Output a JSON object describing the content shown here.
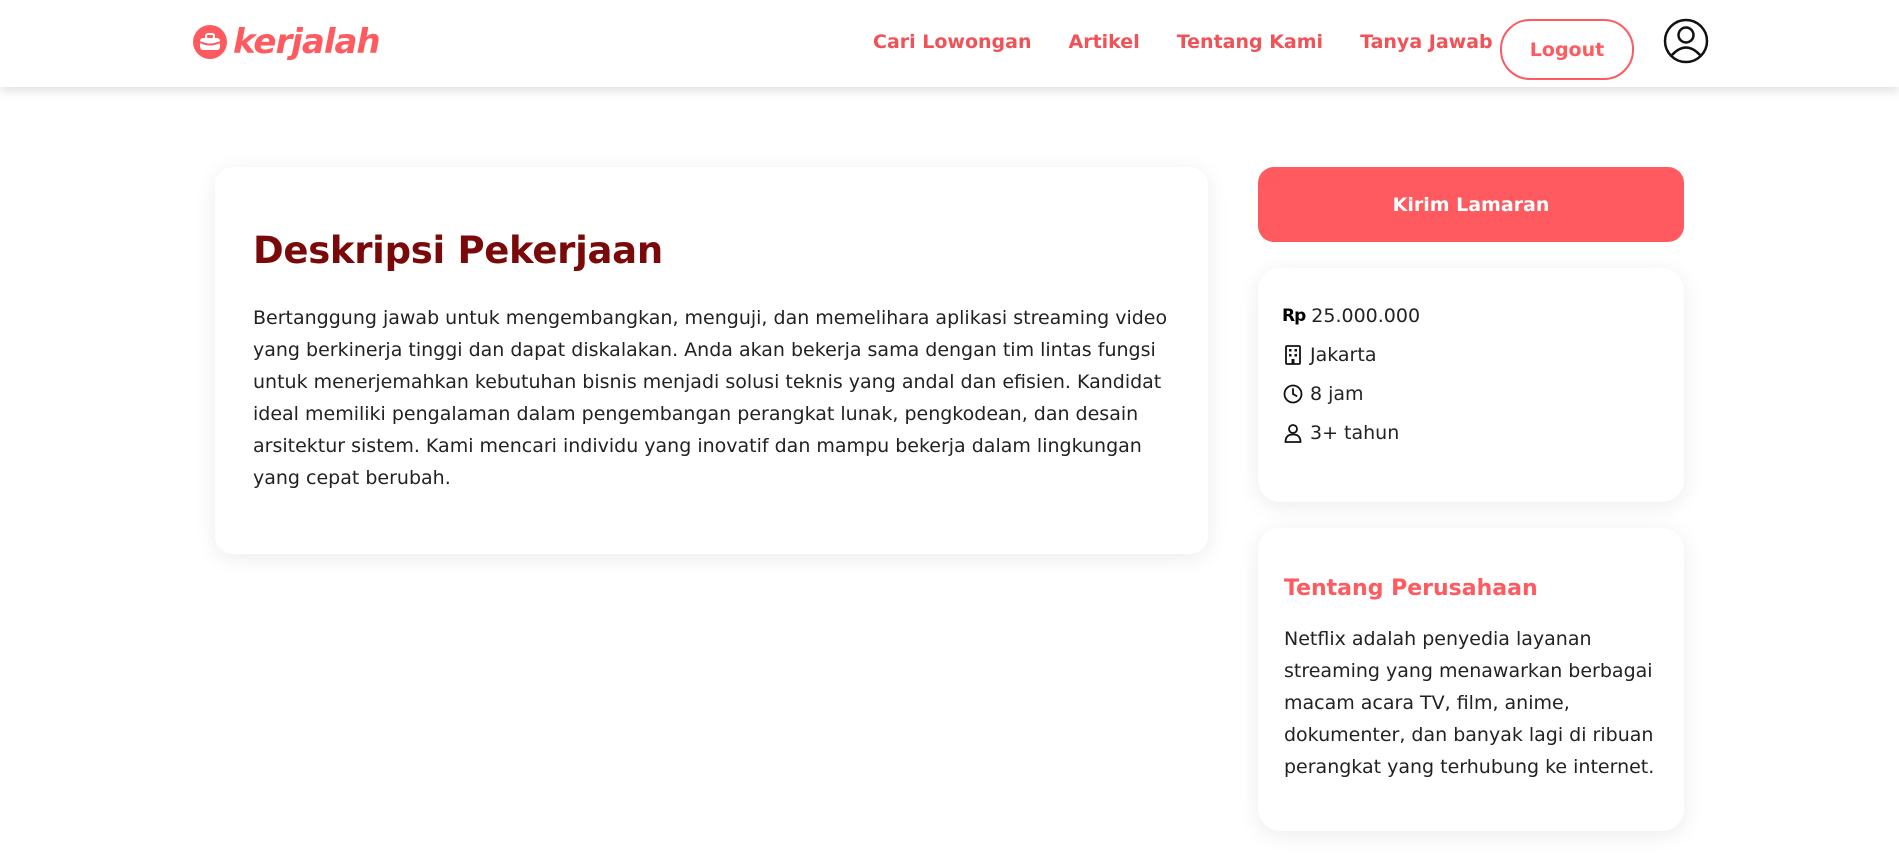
{
  "header": {
    "logo_text": "kerjalah",
    "nav": [
      {
        "label": "Cari Lowongan"
      },
      {
        "label": "Artikel"
      },
      {
        "label": "Tentang Kami"
      },
      {
        "label": "Tanya Jawab"
      }
    ],
    "logout_label": "Logout"
  },
  "job": {
    "title": "Deskripsi Pekerjaan",
    "description": "Bertanggung jawab untuk mengembangkan, menguji, dan memelihara aplikasi streaming video yang berkinerja tinggi dan dapat diskalakan. Anda akan bekerja sama dengan tim lintas fungsi untuk menerjemahkan kebutuhan bisnis menjadi solusi teknis yang andal dan efisien. Kandidat ideal memiliki pengalaman dalam pengembangan perangkat lunak, pengkodean, dan desain arsitektur sistem. Kami mencari individu yang inovatif dan mampu bekerja dalam lingkungan yang cepat berubah."
  },
  "apply": {
    "label": "Kirim Lamaran"
  },
  "info": {
    "currency": "Rp",
    "salary": "25.000.000",
    "location": "Jakarta",
    "hours": "8 jam",
    "experience": "3+ tahun"
  },
  "company": {
    "title": "Tentang Perusahaan",
    "description": "Netflix adalah penyedia layanan streaming yang menawarkan berbagai macam acara TV, film, anime, dokumenter, dan banyak lagi di ribuan perangkat yang terhubung ke internet."
  },
  "colors": {
    "brand": "#ff5a5f",
    "title_dark_red": "#7a0a0a"
  },
  "icons": {
    "logo": "briefcase-icon",
    "avatar": "user-circle-icon",
    "location": "building-icon",
    "hours": "clock-icon",
    "experience": "person-icon"
  }
}
